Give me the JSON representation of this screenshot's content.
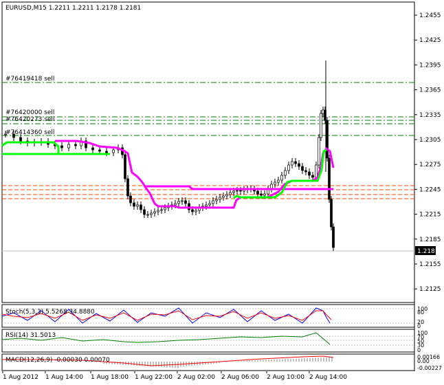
{
  "symbol_header": "EURUSD,M15  1.2211 1.2211 1.2178 1.2181",
  "current_price": "1.2181",
  "price_scale": [
    "1.2455",
    "1.2425",
    "1.2395",
    "1.2365",
    "1.2335",
    "1.2305",
    "1.2275",
    "1.2245",
    "1.2215",
    "1.2185",
    "1.2155",
    "1.2125"
  ],
  "price_scale_values": [
    1.2455,
    1.2425,
    1.2395,
    1.2365,
    1.2335,
    1.2305,
    1.2275,
    1.2245,
    1.2215,
    1.2185,
    1.2155,
    1.2125
  ],
  "order_labels": [
    "#76419418 sell",
    "#76420000 sell",
    "#76420273 sell",
    "#76414360 sell"
  ],
  "time_scale": [
    "1 Aug 2012",
    "1 Aug 14:00",
    "1 Aug 18:00",
    "1 Aug 22:00",
    "2 Aug 02:00",
    "2 Aug 06:00",
    "2 Aug 10:00",
    "2 Aug 14:00"
  ],
  "subwindows": {
    "stoch": {
      "label": "Stoch(5,3,3) 5.5268 34.8880",
      "scale": [
        "100",
        "80",
        "20",
        "0"
      ]
    },
    "rsi": {
      "label": "RSI(14) 31.5013",
      "scale": [
        "100",
        "70",
        "50",
        "30",
        "0"
      ]
    },
    "macd": {
      "label": "MACD(12,26,9) -0.00030 0.00070",
      "scale": [
        "0.00166",
        "0.00",
        "-0.00227"
      ]
    }
  },
  "colors": {
    "background": "#ffffff",
    "candle": "#000000",
    "magenta_line": "#ff00ff",
    "green_line": "#00ff00",
    "sell_order_line": "#008000",
    "orange_level": "#ff4500",
    "red_line": "#ff0000",
    "blue_line": "#0000ff",
    "macd_histogram": "#c0c0c0"
  }
}
